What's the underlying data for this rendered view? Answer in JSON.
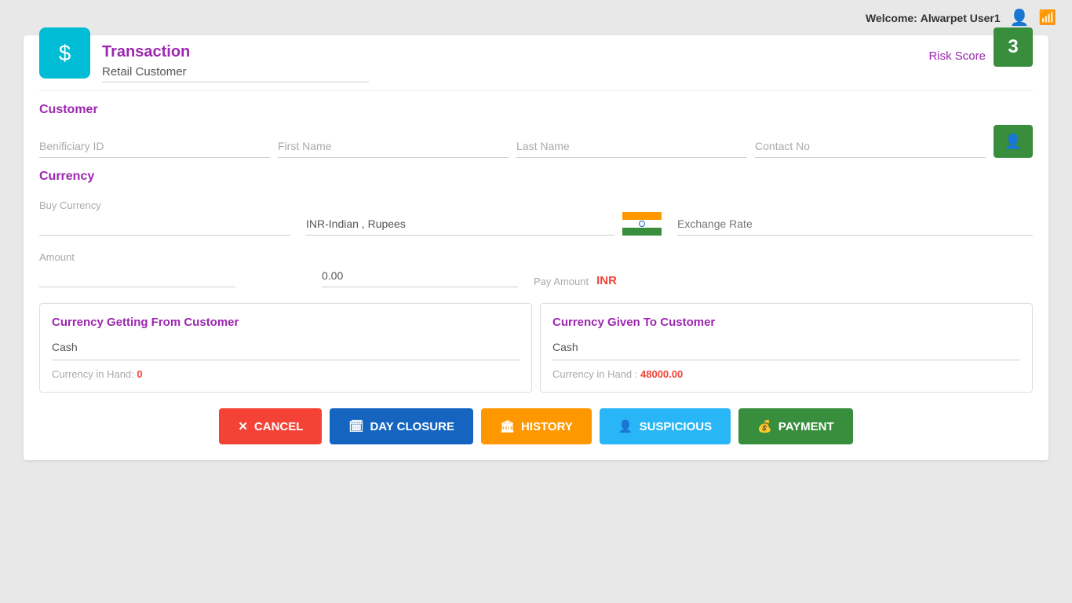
{
  "topbar": {
    "welcome_label": "Welcome:",
    "username": "Alwarpet User1"
  },
  "header": {
    "transaction_label": "Transaction",
    "risk_score_label": "Risk Score",
    "risk_score_value": "3"
  },
  "retail_customer": {
    "label": "Retail Customer"
  },
  "customer_section": {
    "title": "Customer",
    "beneficiary_id_placeholder": "Benificiary ID",
    "first_name_placeholder": "First Name",
    "last_name_placeholder": "Last Name",
    "contact_no_placeholder": "Contact No"
  },
  "currency_section": {
    "title": "Currency",
    "buy_currency_label": "Buy Currency",
    "buy_currency_value": "INR-Indian , Rupees",
    "exchange_rate_placeholder": "Exchange Rate",
    "amount_label": "Amount",
    "amount_value": "0.00",
    "pay_amount_label": "Pay Amount",
    "pay_amount_value": "INR"
  },
  "currency_getting": {
    "title": "Currency Getting From Customer",
    "cash_label": "Cash",
    "currency_in_hand_label": "Currency in Hand:",
    "currency_in_hand_value": "0",
    "currency_in_hand_zero_color": "#f44336"
  },
  "currency_given": {
    "title": "Currency Given To Customer",
    "cash_label": "Cash",
    "currency_in_hand_label": "Currency in Hand :",
    "currency_in_hand_value": "48000.00"
  },
  "buttons": {
    "cancel": "CANCEL",
    "day_closure": "DAY CLOSURE",
    "history": "HISTORY",
    "suspicious": "SUSPICIOUS",
    "payment": "PAYMENT"
  }
}
